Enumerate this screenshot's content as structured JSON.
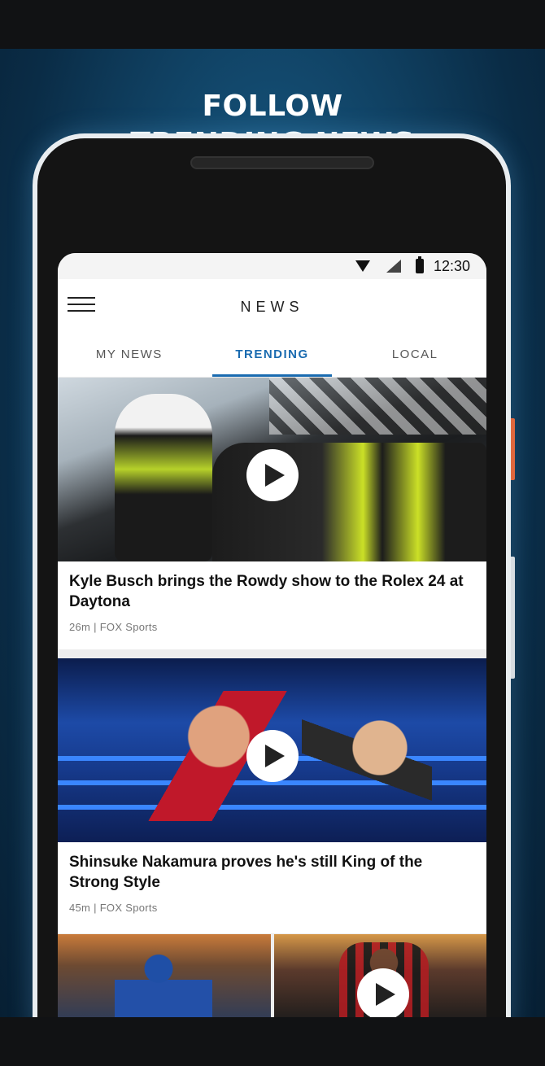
{
  "promo": {
    "headline_line1": "FOLLOW",
    "headline_line2": "TRENDING NEWS"
  },
  "status_bar": {
    "time": "12:30",
    "icons": [
      "wifi-icon",
      "signal-icon",
      "battery-icon"
    ]
  },
  "app_bar": {
    "title": "NEWS",
    "menu_icon": "hamburger-menu-icon"
  },
  "tabs": [
    {
      "label": "MY NEWS",
      "active": false
    },
    {
      "label": "TRENDING",
      "active": true
    },
    {
      "label": "LOCAL",
      "active": false
    }
  ],
  "articles": [
    {
      "title": "Kyle Busch brings the Rowdy show to the Rolex 24 at Daytona",
      "time": "26m",
      "source": "FOX Sports",
      "meta": "26m  |  FOX Sports",
      "has_video": true
    },
    {
      "title": "Shinsuke Nakamura proves he's still King of the Strong Style",
      "time": "45m",
      "source": "FOX Sports",
      "meta": "45m  |  FOX Sports",
      "has_video": true
    }
  ],
  "thumbnails": [
    {
      "has_video": false
    },
    {
      "has_video": true
    }
  ],
  "colors": {
    "accent": "#1a6bb0",
    "background_top": "#1f6b99",
    "background_bottom": "#071f33"
  }
}
